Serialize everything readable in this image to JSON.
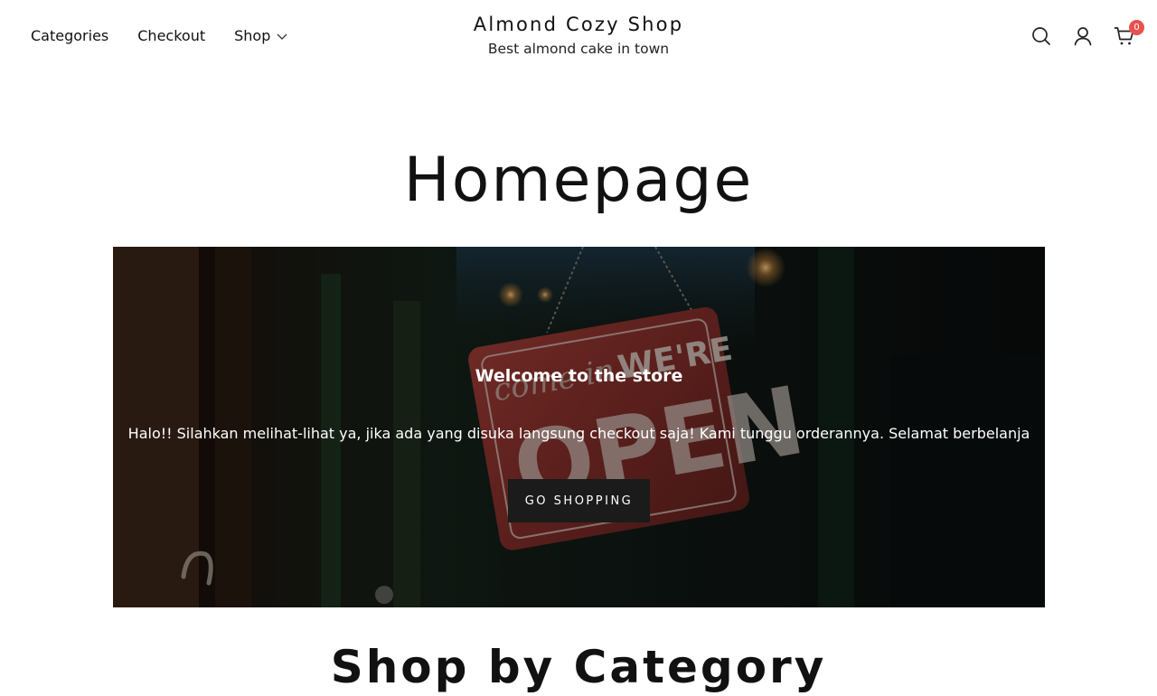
{
  "header": {
    "nav": [
      {
        "label": "Categories"
      },
      {
        "label": "Checkout"
      },
      {
        "label": "Shop"
      }
    ],
    "brand_title": "Almond Cozy Shop",
    "brand_tagline": "Best almond cake in town",
    "icons": [
      "search-icon",
      "user-icon",
      "cart-icon",
      "chevron-down-icon"
    ],
    "cart_count": "0"
  },
  "page_title": "Homepage",
  "hero": {
    "heading": "Welcome to the store",
    "text": "Halo!! Silahkan melihat-lihat ya, jika ada yang disuka langsung checkout saja! Kami tunggu orderannya. Selamat berbelanja",
    "button_label": "GO SHOPPING",
    "sign_text": [
      "come in",
      "WE'RE",
      "OPEN"
    ]
  },
  "section_title": "Shop by Category",
  "colors": {
    "badge": "#e8524c",
    "button_bg": "#1b1b1b",
    "sign_red": "#8a2e2a"
  }
}
